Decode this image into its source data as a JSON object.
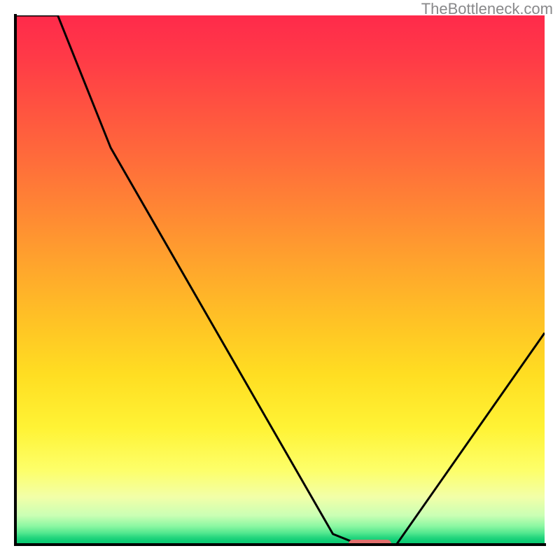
{
  "watermark": "TheBottleneck.com",
  "marker_color": "#e26f6d",
  "chart_data": {
    "type": "line",
    "title": "",
    "xlabel": "",
    "ylabel": "",
    "xlim": [
      0,
      100
    ],
    "ylim": [
      0,
      100
    ],
    "x": [
      0,
      8,
      18,
      60,
      65,
      72,
      100
    ],
    "values": [
      100,
      100,
      75,
      2,
      0,
      0,
      40
    ],
    "optimal_range_x": [
      63,
      71
    ],
    "optimal_range_y": 0,
    "notes": "Vertical gradient background from red (top) through orange, yellow, to green (bottom). Black V-shaped curve descending steeply from left, flat minimum around x≈63–71, rising to the right. A short horizontal pink-red marker highlights the flat minimum on the green band."
  }
}
